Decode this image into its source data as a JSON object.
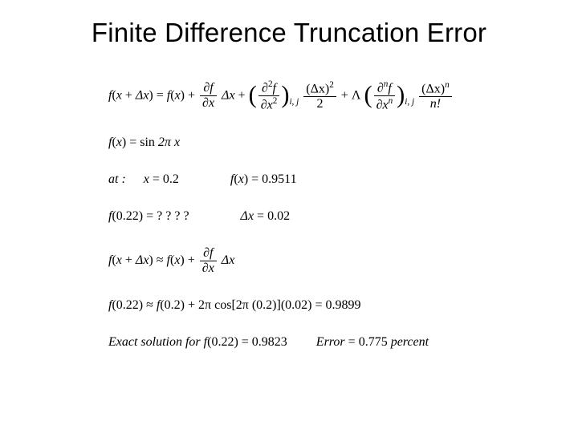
{
  "title": "Finite Difference Truncation Error",
  "taylor": {
    "lhs": "f",
    "lhs_arg_a": "x",
    "lhs_arg_b": "Δx",
    "eq": "=",
    "term0": "f",
    "term0_arg": "x",
    "plus": "+",
    "d1_num": "∂f",
    "d1_den": "∂x",
    "dx": "Δx",
    "d2_num": "∂",
    "d2_sup": "2",
    "d2_num2": "f",
    "d2_den": "∂x",
    "d2_densup": "2",
    "sub": "i, j",
    "coef2_num": "(Δx)",
    "coef2_sup": "2",
    "coef2_den": "2",
    "lambda": "Λ",
    "dn_num": "∂",
    "dn_sup": "n",
    "dn_num2": "f",
    "dn_den": "∂x",
    "dn_densup": "n",
    "coefn_num": "(Δx)",
    "coefn_sup": "n",
    "coefn_den": "n!"
  },
  "fdef": {
    "lhs": "f",
    "arg": "x",
    "eq": "=",
    "rhs_a": "sin",
    "rhs_b": "2π x"
  },
  "at": {
    "label": "at :",
    "xvar": "x",
    "eq": "=",
    "xval": "0.2",
    "fx": "f",
    "fxarg": "x",
    "fxval": "0.9511"
  },
  "query": {
    "f": "f",
    "arg": "0.22",
    "eq": "=",
    "q": "? ? ? ?",
    "dx": "Δx",
    "dxval": "0.02"
  },
  "approx": {
    "lhs": "f",
    "lhs_arg_a": "x",
    "lhs_arg_b": "Δx",
    "approx": "≈",
    "term0": "f",
    "term0_arg": "x",
    "plus": "+",
    "d1_num": "∂f",
    "d1_den": "∂x",
    "dx": "Δx"
  },
  "calc": {
    "f": "f",
    "arg": "0.22",
    "approx": "≈",
    "f2": "f",
    "arg2": "0.2",
    "plus": "+",
    "coef": "2π",
    "cos": "cos",
    "cosarg": "2π (0.2)",
    "mult": "(0.02)",
    "eq": "=",
    "val": "0.9899"
  },
  "exact": {
    "label_a": "Exact solution for",
    "f": "f",
    "arg": "0.22",
    "eq": "=",
    "val": "0.9823",
    "errlabel": "Error",
    "errval": "0.775",
    "errunit": "percent"
  }
}
